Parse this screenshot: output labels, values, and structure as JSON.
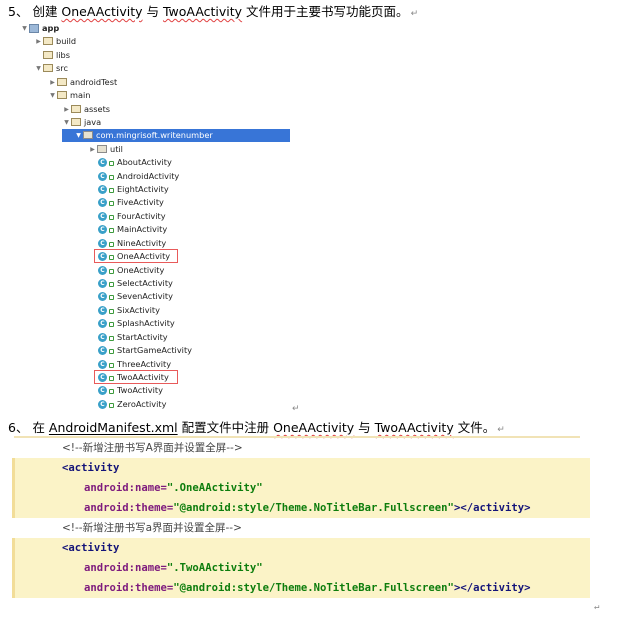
{
  "heading5": {
    "num": "5、",
    "p1": "创建 ",
    "w1": "OneAActivity",
    "p2": " 与 ",
    "w2": "TwoAActivity",
    "p3": " 文件用于主要书写功能页面。",
    "mark": "↵"
  },
  "tree": {
    "rows": [
      {
        "label": "app",
        "kind": "app"
      },
      {
        "label": "build",
        "kind": "folder"
      },
      {
        "label": "libs",
        "kind": "folder"
      },
      {
        "label": "src",
        "kind": "folder"
      },
      {
        "label": "androidTest",
        "kind": "folder"
      },
      {
        "label": "main",
        "kind": "folder"
      },
      {
        "label": "assets",
        "kind": "folder"
      },
      {
        "label": "java",
        "kind": "folder"
      },
      {
        "label": "com.mingrisoft.writenumber",
        "kind": "pkg"
      },
      {
        "label": "util",
        "kind": "pkg"
      },
      {
        "label": "AboutActivity",
        "kind": "class"
      },
      {
        "label": "AndroidActivity",
        "kind": "class"
      },
      {
        "label": "EightActivity",
        "kind": "class"
      },
      {
        "label": "FiveActivity",
        "kind": "class"
      },
      {
        "label": "FourActivity",
        "kind": "class"
      },
      {
        "label": "MainActivity",
        "kind": "class"
      },
      {
        "label": "NineActivity",
        "kind": "class"
      },
      {
        "label": "OneAActivity",
        "kind": "class"
      },
      {
        "label": "OneActivity",
        "kind": "class"
      },
      {
        "label": "SelectActivity",
        "kind": "class"
      },
      {
        "label": "SevenActivity",
        "kind": "class"
      },
      {
        "label": "SixActivity",
        "kind": "class"
      },
      {
        "label": "SplashActivity",
        "kind": "class"
      },
      {
        "label": "StartActivity",
        "kind": "class"
      },
      {
        "label": "StartGameActivity",
        "kind": "class"
      },
      {
        "label": "ThreeActivity",
        "kind": "class"
      },
      {
        "label": "TwoAActivity",
        "kind": "class"
      },
      {
        "label": "TwoActivity",
        "kind": "class"
      },
      {
        "label": "ZeroActivity",
        "kind": "class"
      }
    ],
    "class_icon_letter": "C",
    "highlighted": [
      "OneAActivity",
      "TwoAActivity"
    ]
  },
  "heading6": {
    "num": "6、",
    "p1": "在 ",
    "w1": "AndroidManifest.xml",
    "p2": " 配置文件中注册 ",
    "w2": "OneAActivity",
    "p3": " 与 ",
    "w3": "TwoAActivity",
    "p4": " 文件。",
    "mark": "↵"
  },
  "code": {
    "comment1": "<!--新增注册书写A界面并设置全屏-->",
    "comment2": "<!--新增注册书写a界面并设置全屏-->",
    "open_tag": "<activity",
    "name_attr": "android:name=",
    "name_val1": "\".OneAActivity\"",
    "name_val2": "\".TwoAActivity\"",
    "theme_attr": "android:theme=",
    "theme_val": "\"@android:style/Theme.NoTitleBar.Fullscreen\"",
    "close_tag": "></activity>",
    "end_mark": "↵"
  },
  "colors": {
    "selection": "#3875d7",
    "highlight_box": "#e85a5a",
    "code_bg": "#fbf3c7"
  }
}
